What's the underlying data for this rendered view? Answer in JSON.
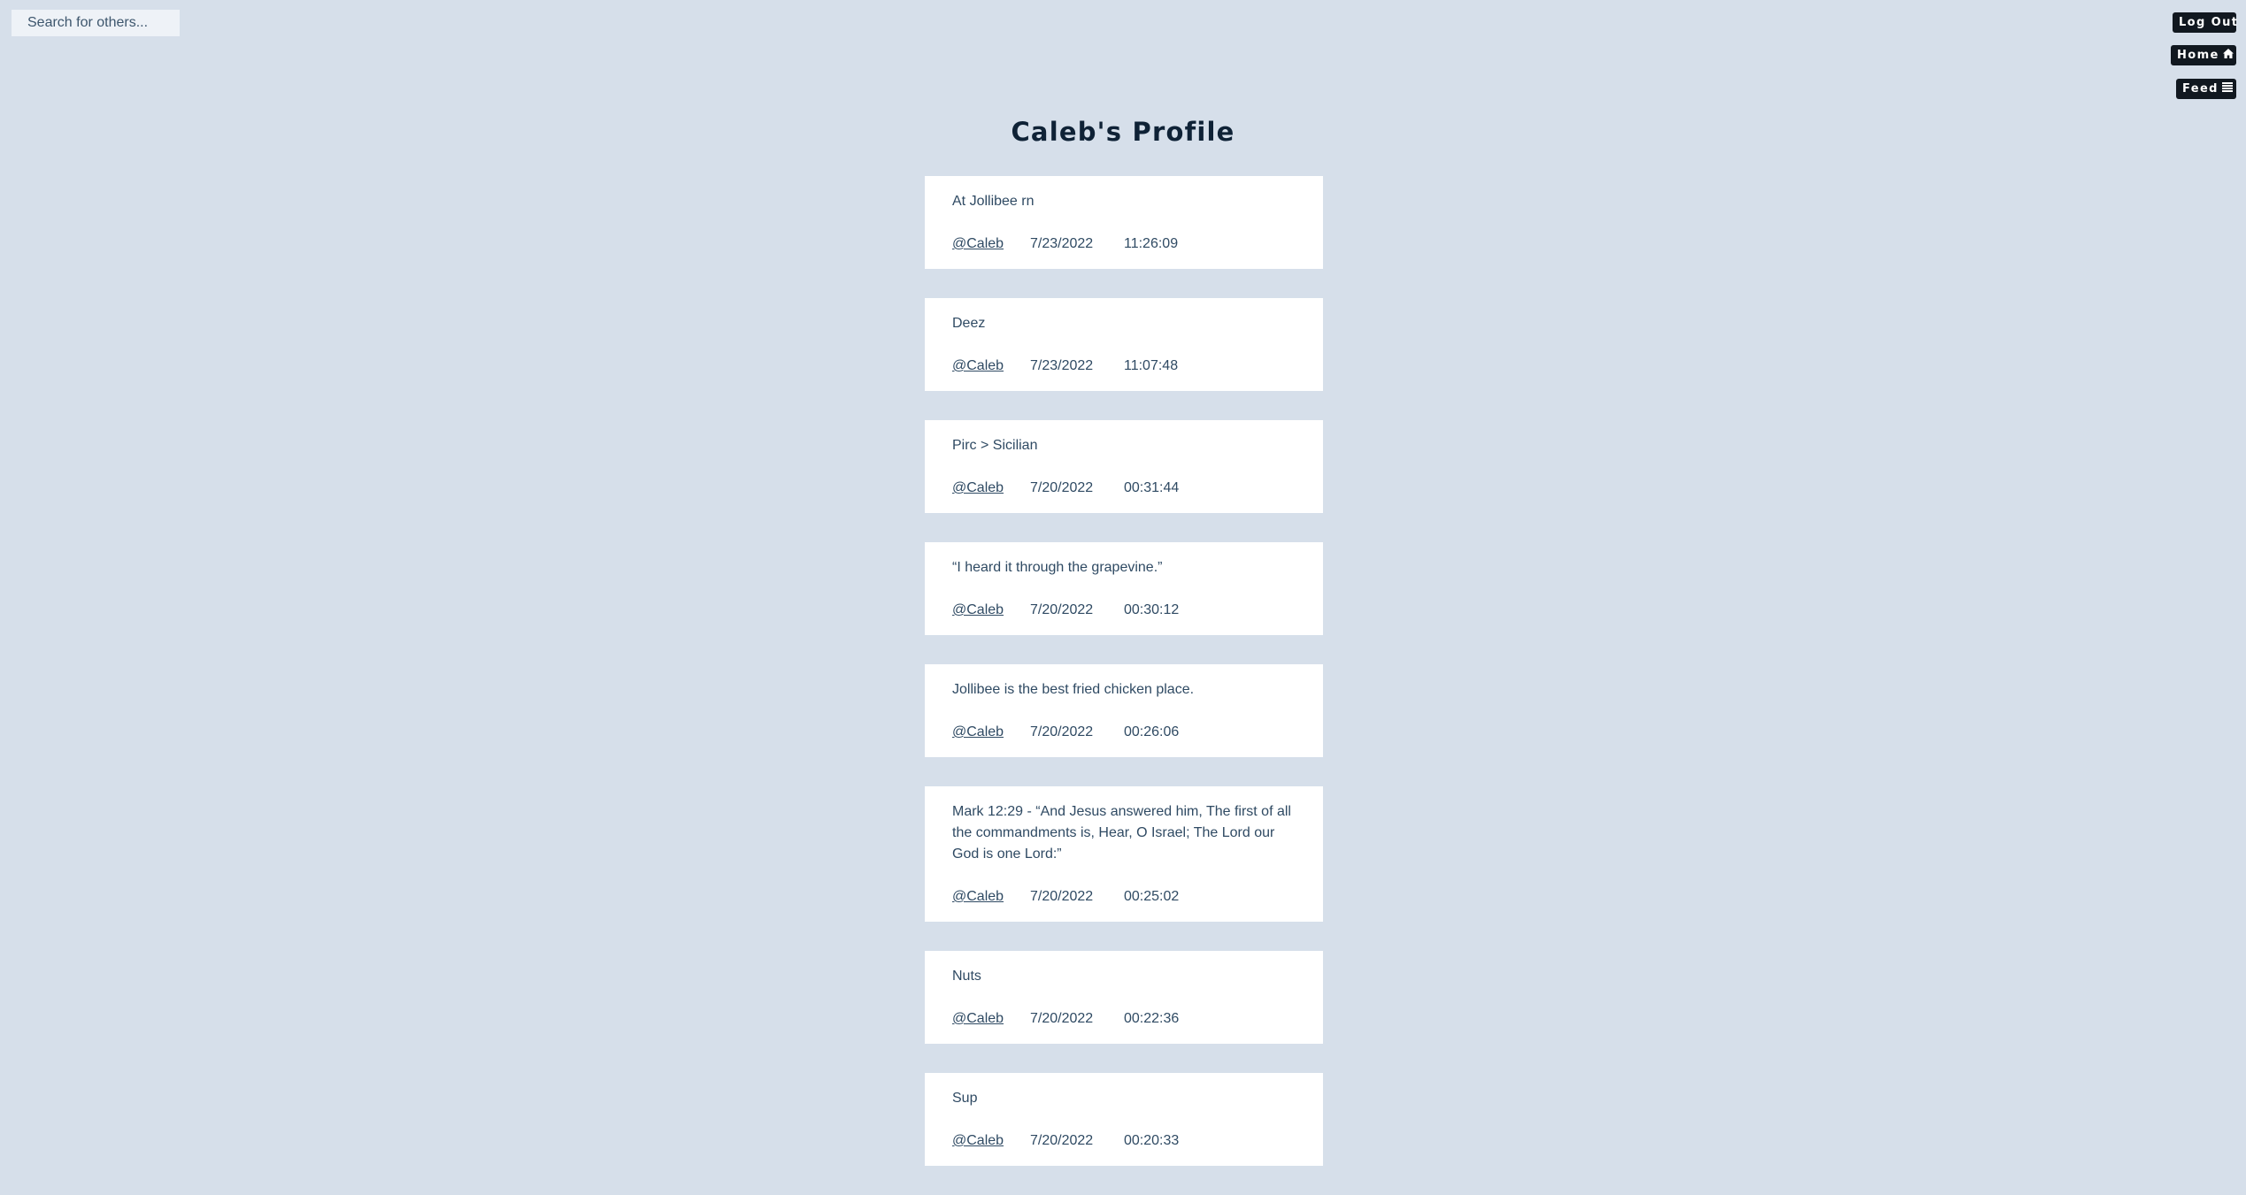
{
  "search": {
    "placeholder": "Search for others..."
  },
  "nav": {
    "logout_label": "Log Out",
    "home_label": "Home",
    "home_icon": "home-icon",
    "feed_label": "Feed",
    "feed_icon": "list-icon"
  },
  "profile": {
    "title": "Caleb's Profile"
  },
  "posts": [
    {
      "text": "At Jollibee rn",
      "author": "@Caleb",
      "date": "7/23/2022",
      "time": "11:26:09"
    },
    {
      "text": "Deez",
      "author": "@Caleb",
      "date": "7/23/2022",
      "time": "11:07:48"
    },
    {
      "text": "Pirc > Sicilian",
      "author": "@Caleb",
      "date": "7/20/2022",
      "time": "00:31:44"
    },
    {
      "text": "“I heard it through the grapevine.”",
      "author": "@Caleb",
      "date": "7/20/2022",
      "time": "00:30:12"
    },
    {
      "text": "Jollibee is the best fried chicken place.",
      "author": "@Caleb",
      "date": "7/20/2022",
      "time": "00:26:06"
    },
    {
      "text": "Mark 12:29 - “And Jesus answered him, The first of all the commandments is, Hear, O Israel; The Lord our God is one Lord:”",
      "author": "@Caleb",
      "date": "7/20/2022",
      "time": "00:25:02"
    },
    {
      "text": "Nuts",
      "author": "@Caleb",
      "date": "7/20/2022",
      "time": "00:22:36"
    },
    {
      "text": "Sup",
      "author": "@Caleb",
      "date": "7/20/2022",
      "time": "00:20:33"
    }
  ],
  "colors": {
    "background": "#d6dfea",
    "card": "#ffffff",
    "text": "#2f4a63",
    "title": "#0f2236",
    "button": "#111820"
  }
}
